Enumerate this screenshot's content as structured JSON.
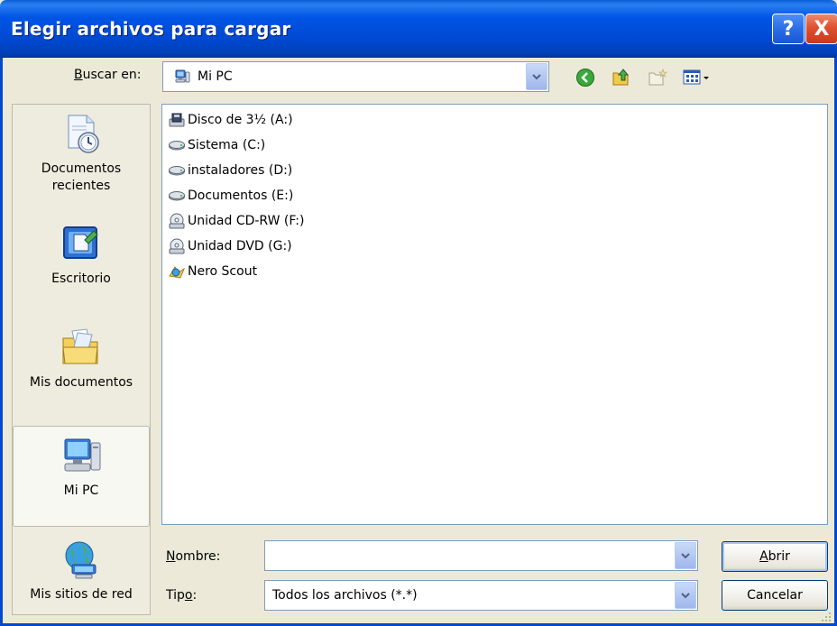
{
  "window": {
    "title": "Elegir archivos para cargar",
    "help_label": "?",
    "close_label": "X"
  },
  "look_in": {
    "label_prefix": "B",
    "label_rest": "uscar en:",
    "value": "Mi PC",
    "icon": "my-computer-icon"
  },
  "toolbar": {
    "back": "back-icon",
    "up": "up-folder-icon",
    "new_folder": "new-folder-icon",
    "views": "views-menu-icon"
  },
  "places": [
    {
      "label": "Documentos recientes",
      "icon": "recent-documents-icon"
    },
    {
      "label": "Escritorio",
      "icon": "desktop-icon"
    },
    {
      "label": "Mis documentos",
      "icon": "my-documents-icon"
    },
    {
      "label": "Mi PC",
      "icon": "my-computer-icon",
      "selected": true
    },
    {
      "label": "Mis sitios de red",
      "icon": "network-places-icon"
    }
  ],
  "files": [
    {
      "label": "Disco de 3½ (A:)",
      "icon": "floppy-drive-icon"
    },
    {
      "label": "Sistema (C:)",
      "icon": "hard-drive-icon"
    },
    {
      "label": "instaladores (D:)",
      "icon": "hard-drive-icon"
    },
    {
      "label": "Documentos (E:)",
      "icon": "hard-drive-icon"
    },
    {
      "label": "Unidad CD-RW (F:)",
      "icon": "cd-drive-icon"
    },
    {
      "label": "Unidad DVD (G:)",
      "icon": "dvd-drive-icon"
    },
    {
      "label": "Nero Scout",
      "icon": "nero-scout-icon"
    }
  ],
  "filename": {
    "label_prefix": "N",
    "label_rest": "ombre:",
    "value": ""
  },
  "filetype": {
    "label_start": "Tip",
    "label_underline": "o",
    "label_end": ":",
    "value": "Todos los archivos (*.*)"
  },
  "buttons": {
    "open_prefix": "A",
    "open_rest": "brir",
    "cancel": "Cancelar"
  },
  "colors": {
    "title_bar": "#0055e5",
    "dialog_bg": "#ece9d8",
    "border": "#7f9db9"
  }
}
